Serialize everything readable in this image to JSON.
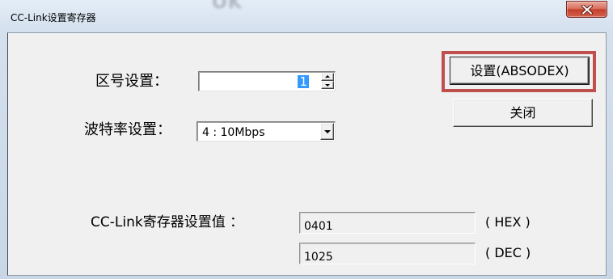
{
  "window": {
    "title": "CC-Link设置寄存器",
    "ghost_text": "OK",
    "close_icon": "close-icon"
  },
  "station": {
    "label": "区号设置：",
    "value": "1",
    "spin_up_icon": "arrow-up-icon",
    "spin_down_icon": "arrow-down-icon"
  },
  "baud_rate": {
    "label": "波特率设置：",
    "selected": "4 : 10Mbps",
    "dropdown_icon": "arrow-down-icon"
  },
  "buttons": {
    "set_absodex": "设置(ABSODEX)",
    "close": "关闭"
  },
  "register": {
    "label": "CC-Link寄存器设置值 ：",
    "hex_value": "0401",
    "hex_unit": "( HEX )",
    "dec_value": "1025",
    "dec_unit": "( DEC )"
  },
  "colors": {
    "highlight_frame": "#c0504d",
    "close_button": "#c3412d",
    "selection": "#3399ff",
    "panel": "#f0f0f0"
  }
}
